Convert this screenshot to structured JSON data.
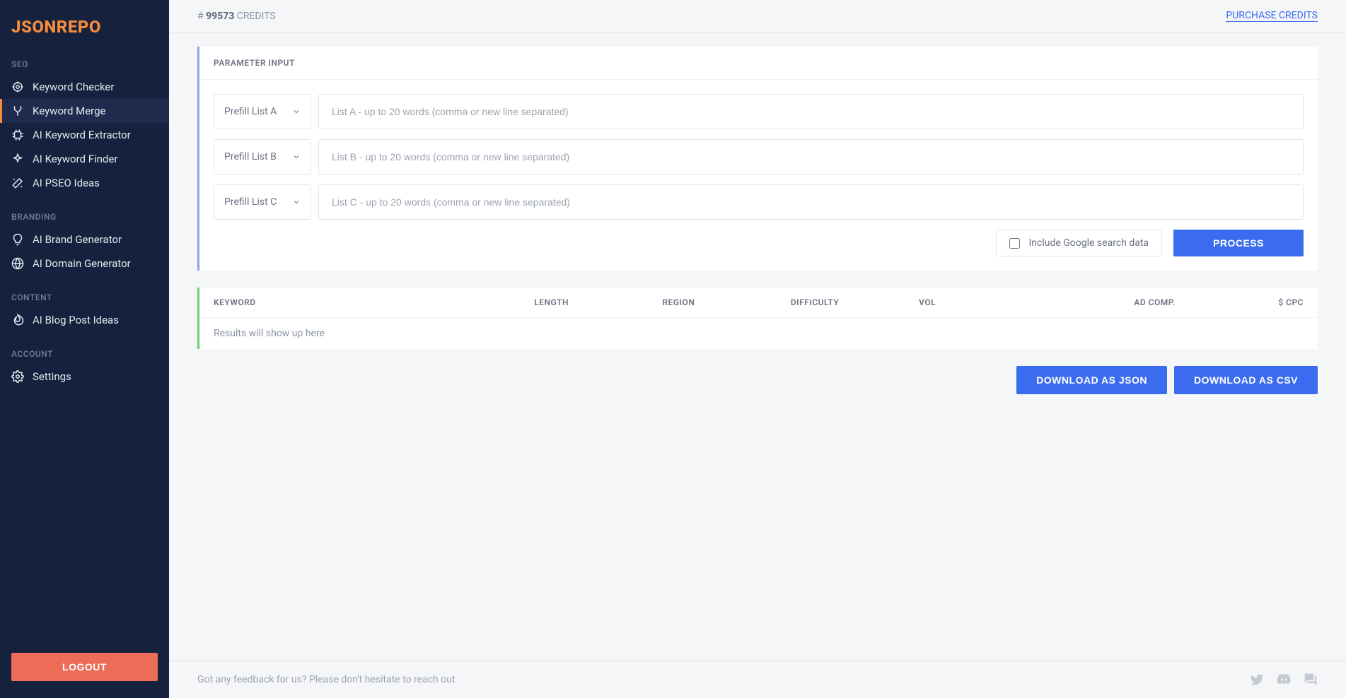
{
  "logo": "JSONREPO",
  "sidebar": {
    "sections": [
      {
        "heading": "SEO",
        "items": [
          {
            "label": "Keyword Checker",
            "icon": "target-icon",
            "active": false
          },
          {
            "label": "Keyword Merge",
            "icon": "merge-icon",
            "active": true
          },
          {
            "label": "AI Keyword Extractor",
            "icon": "chip-icon",
            "active": false
          },
          {
            "label": "AI Keyword Finder",
            "icon": "sparkle-icon",
            "active": false
          },
          {
            "label": "AI PSEO Ideas",
            "icon": "wand-icon",
            "active": false
          }
        ]
      },
      {
        "heading": "BRANDING",
        "items": [
          {
            "label": "AI Brand Generator",
            "icon": "bulb-icon",
            "active": false
          },
          {
            "label": "AI Domain Generator",
            "icon": "globe-icon",
            "active": false
          }
        ]
      },
      {
        "heading": "CONTENT",
        "items": [
          {
            "label": "AI Blog Post Ideas",
            "icon": "fire-icon",
            "active": false
          }
        ]
      },
      {
        "heading": "ACCOUNT",
        "items": [
          {
            "label": "Settings",
            "icon": "gear-icon",
            "active": false
          }
        ]
      }
    ],
    "logout": "LOGOUT"
  },
  "topbar": {
    "credits_prefix": "# ",
    "credits_number": "99573",
    "credits_suffix": " CREDITS",
    "purchase": "PURCHASE CREDITS"
  },
  "parameter_input": {
    "heading": "PARAMETER INPUT",
    "rows": [
      {
        "select_label": "Prefill List A",
        "placeholder": "List A - up to 20 words (comma or new line separated)"
      },
      {
        "select_label": "Prefill List B",
        "placeholder": "List B - up to 20 words (comma or new line separated)"
      },
      {
        "select_label": "Prefill List C",
        "placeholder": "List C - up to 20 words (comma or new line separated)"
      }
    ],
    "checkbox_label": "Include Google search data",
    "process": "PROCESS"
  },
  "results": {
    "columns": [
      "KEYWORD",
      "LENGTH",
      "REGION",
      "DIFFICULTY",
      "VOL",
      "AD COMP.",
      "$ CPC"
    ],
    "empty": "Results will show up here",
    "download_json": "DOWNLOAD AS JSON",
    "download_csv": "DOWNLOAD AS CSV"
  },
  "footer": {
    "text": "Got any feedback for us? Please don't hesitate to reach out"
  }
}
